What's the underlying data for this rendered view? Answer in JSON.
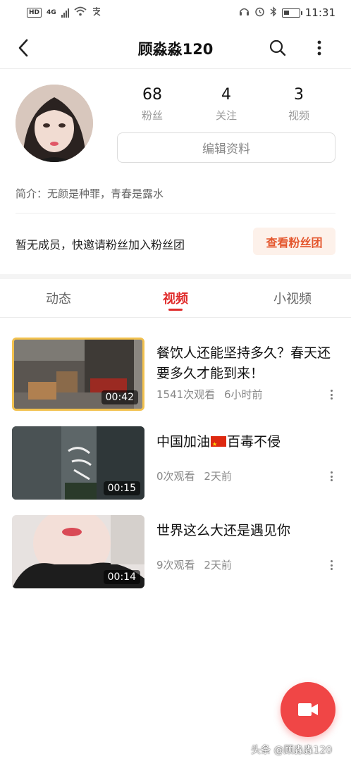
{
  "status_bar": {
    "hd": "HD",
    "network": "4G",
    "time": "11:31"
  },
  "header": {
    "title": "顾淼淼120"
  },
  "profile": {
    "stats": [
      {
        "value": "68",
        "label": "粉丝"
      },
      {
        "value": "4",
        "label": "关注"
      },
      {
        "value": "3",
        "label": "视频"
      }
    ],
    "edit_label": "编辑资料",
    "bio": "简介：无颜是种罪，青春是露水"
  },
  "fans": {
    "text": "暂无成员，快邀请粉丝加入粉丝团",
    "button_label": "查看粉丝团"
  },
  "tabs": [
    {
      "label": "动态",
      "active": false
    },
    {
      "label": "视频",
      "active": true
    },
    {
      "label": "小视频",
      "active": false
    }
  ],
  "videos": [
    {
      "title": "餐饮人还能坚持多久？春天还要多久才能到来！",
      "views": "1541次观看",
      "time": "6小时前",
      "duration": "00:42"
    },
    {
      "title_before": "中国加油",
      "title_after": "百毒不侵",
      "views": "0次观看",
      "time": "2天前",
      "duration": "00:15"
    },
    {
      "title": "世界这么大还是遇见你",
      "views": "9次观看",
      "time": "2天前",
      "duration": "00:14"
    }
  ],
  "watermark": "头条 @顾淼淼120",
  "colors": {
    "accent": "#e02a2a",
    "fan_button_bg": "#fdf1ea",
    "fan_button_text": "#e4572e",
    "fab": "#f04646"
  },
  "icons": [
    "back-arrow-icon",
    "search-icon",
    "more-vertical-icon",
    "video-camera-icon"
  ]
}
